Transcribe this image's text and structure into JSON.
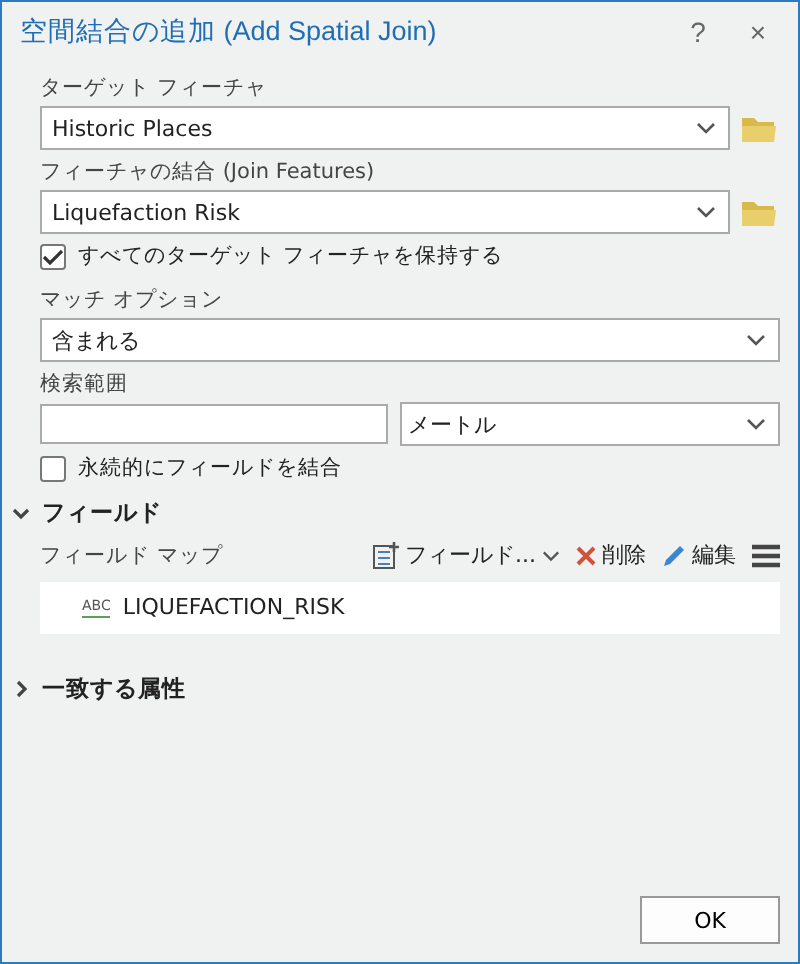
{
  "window": {
    "title": "空間結合の追加 (Add Spatial Join)",
    "help": "?",
    "close": "×"
  },
  "parameters": [
    {
      "kind": "dropdown",
      "label": "ターゲット フィーチャ",
      "value": "Historic Places",
      "browse": true
    },
    {
      "kind": "dropdown",
      "label": "フィーチャの結合 (Join Features)",
      "value": "Liquefaction Risk",
      "browse": true
    },
    {
      "kind": "checkbox",
      "label": "すべてのターゲット フィーチャを保持する",
      "checked": true
    },
    {
      "kind": "dropdown",
      "label": "マッチ オプション",
      "value": "含まれる",
      "browse": false
    },
    {
      "kind": "distance",
      "label": "検索範囲",
      "unit": "メートル"
    },
    {
      "kind": "checkbox",
      "label": "永続的にフィールドを結合",
      "checked": false
    }
  ],
  "fields_section": {
    "title": "フィールド",
    "expanded": true,
    "field_map_label": "フィールド マップ",
    "add_button": "フィールド...",
    "delete_button": "削除",
    "edit_button": "編集",
    "rows": [
      {
        "type": "ABC",
        "name": "LIQUEFACTION_RISK"
      }
    ]
  },
  "matching_section": {
    "title": "一致する属性",
    "expanded": false
  },
  "ok_button": "OK"
}
